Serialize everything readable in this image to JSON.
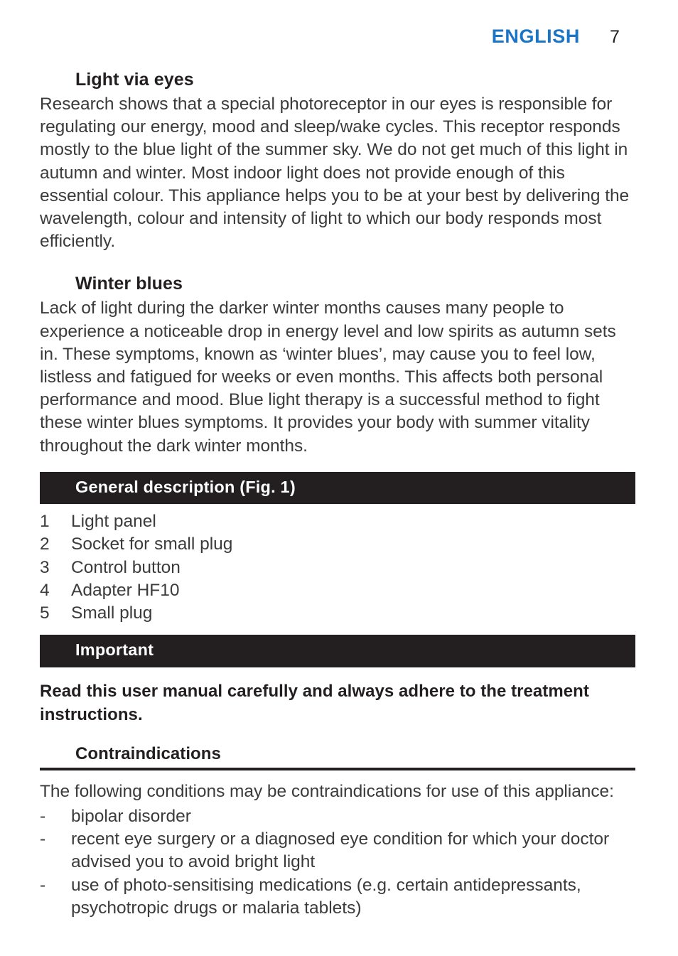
{
  "header": {
    "language": "ENGLISH",
    "page_number": "7",
    "accent_color": "#1b74c4"
  },
  "theme": {
    "banner_bg": "#231f20",
    "banner_text": "#ffffff",
    "body_text": "#3b3b3b",
    "heading_text": "#231f20"
  },
  "sections": {
    "light_via_eyes": {
      "heading": "Light via eyes",
      "paragraph": "Research shows that a special photoreceptor in our eyes is responsible for regulating our energy, mood and sleep/wake cycles. This receptor responds mostly to the blue light of the summer sky. We do not get much of this light in autumn and winter. Most indoor light does not provide enough of this essential colour. This appliance helps you to be at your best by delivering the wavelength, colour and intensity of light to which our body responds most efficiently."
    },
    "winter_blues": {
      "heading": "Winter blues",
      "paragraph": "Lack of light during the darker winter months causes many people to experience a noticeable drop in energy level and low spirits as autumn sets in. These symptoms, known as ‘winter blues’, may cause you to feel low, listless and fatigued for weeks or even months. This affects both personal performance and mood. Blue light therapy is a successful method to fight these winter blues symptoms. It provides your body with summer vitality throughout the dark winter months."
    },
    "general_description": {
      "banner": "General description (Fig. 1)",
      "items": [
        {
          "number": "1",
          "label": "Light panel"
        },
        {
          "number": "2",
          "label": "Socket for small plug"
        },
        {
          "number": "3",
          "label": "Control button"
        },
        {
          "number": "4",
          "label": "Adapter HF10"
        },
        {
          "number": "5",
          "label": "Small plug"
        }
      ]
    },
    "important": {
      "banner": "Important",
      "lead": "Read this user manual carefully and always adhere to the treatment instructions.",
      "contraindications": {
        "heading": "Contraindications",
        "intro": "The following conditions may be contraindications for use of this appliance:",
        "bullet_marker": "-",
        "items": [
          "bipolar disorder",
          "recent eye surgery or a diagnosed eye condition for which your doctor advised you to avoid bright light",
          "use of photo-sensitising medications (e.g. certain antidepressants, psychotropic drugs or malaria tablets)"
        ]
      }
    }
  }
}
